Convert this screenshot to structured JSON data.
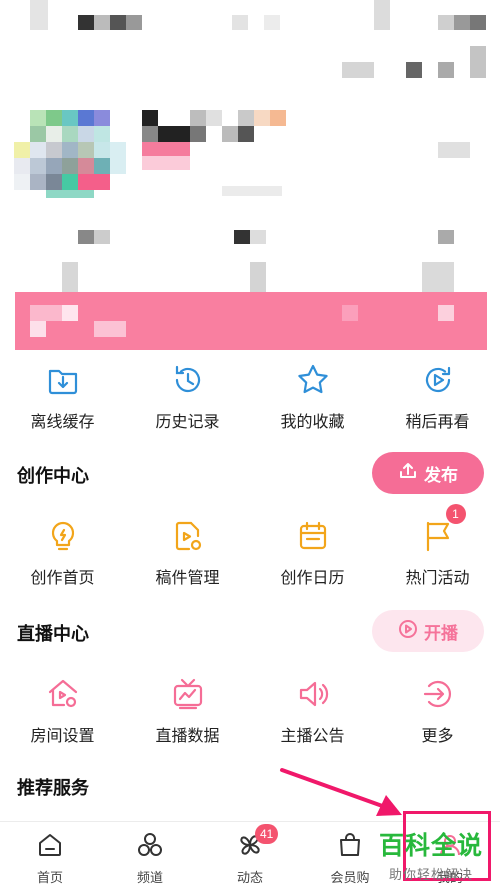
{
  "quick_actions": [
    {
      "label": "离线缓存",
      "icon": "download-folder-icon"
    },
    {
      "label": "历史记录",
      "icon": "history-clock-icon"
    },
    {
      "label": "我的收藏",
      "icon": "star-icon"
    },
    {
      "label": "稍后再看",
      "icon": "watch-later-icon"
    }
  ],
  "creation_center": {
    "title": "创作中心",
    "publish_label": "发布",
    "items": [
      {
        "label": "创作首页",
        "icon": "lightbulb-icon"
      },
      {
        "label": "稿件管理",
        "icon": "manuscript-icon"
      },
      {
        "label": "创作日历",
        "icon": "calendar-icon"
      },
      {
        "label": "热门活动",
        "icon": "flag-icon",
        "badge": "1"
      }
    ]
  },
  "live_center": {
    "title": "直播中心",
    "live_label": "开播",
    "items": [
      {
        "label": "房间设置",
        "icon": "room-settings-icon"
      },
      {
        "label": "直播数据",
        "icon": "tv-data-icon"
      },
      {
        "label": "主播公告",
        "icon": "speaker-icon"
      },
      {
        "label": "更多",
        "icon": "more-arrow-icon"
      }
    ]
  },
  "recommended": {
    "title": "推荐服务"
  },
  "tabbar": [
    {
      "label": "首页",
      "icon": "home-icon"
    },
    {
      "label": "频道",
      "icon": "channel-icon"
    },
    {
      "label": "动态",
      "icon": "pinwheel-icon",
      "badge": "41"
    },
    {
      "label": "会员购",
      "icon": "shopping-bag-icon"
    },
    {
      "label": "我的",
      "icon": "profile-icon"
    }
  ],
  "watermark": {
    "title": "百科全说",
    "subtitle": "助你轻松解决"
  },
  "colors": {
    "accent_blue": "#2f8fd8",
    "accent_yellow": "#f2a51a",
    "accent_pink": "#f56d96",
    "highlight_red": "#f0186a",
    "watermark_green": "#28b83c"
  }
}
